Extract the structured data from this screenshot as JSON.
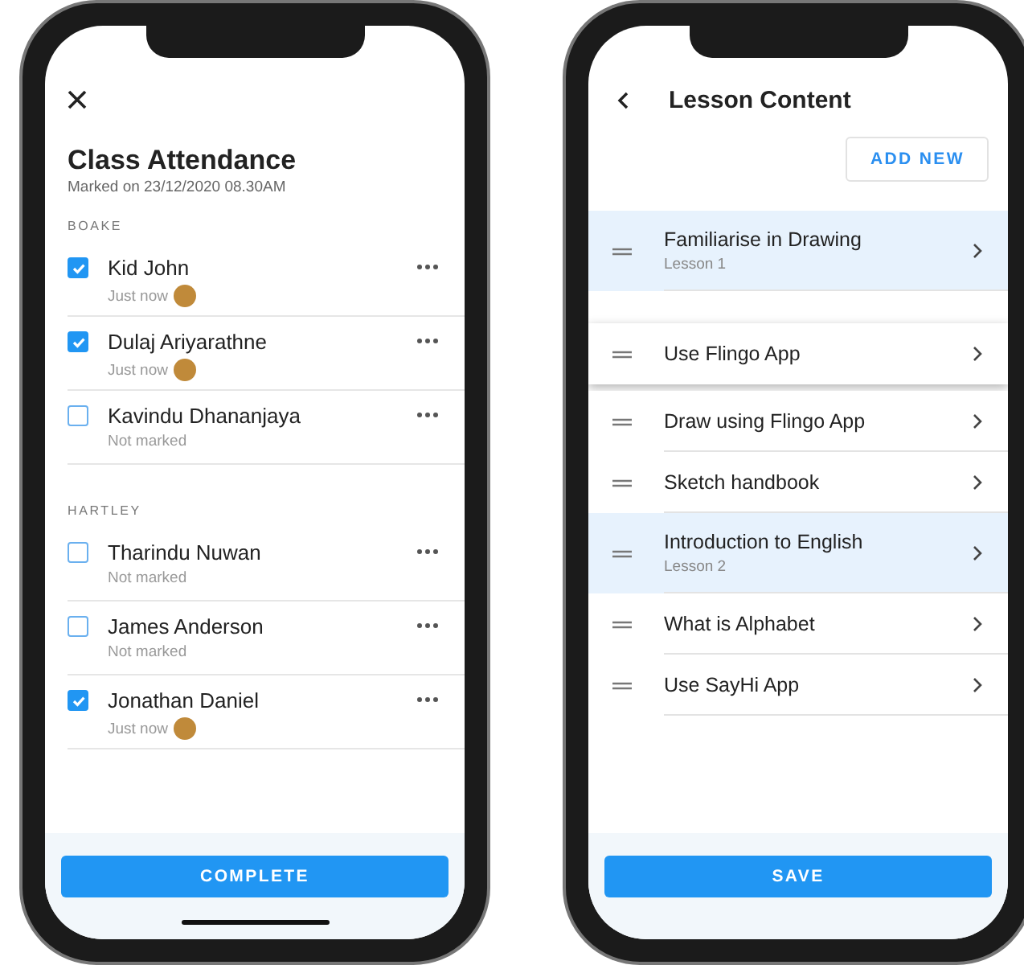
{
  "attendance_screen": {
    "title": "Class Attendance",
    "subtitle": "Marked on 23/12/2020 08.30AM",
    "groups": [
      {
        "name": "BOAKE",
        "students": [
          {
            "name": "Kid John",
            "status": "Just now",
            "checked": true
          },
          {
            "name": "Dulaj Ariyarathne",
            "status": "Just now",
            "checked": true
          },
          {
            "name": "Kavindu Dhananjaya",
            "status": "Not marked",
            "checked": false
          }
        ]
      },
      {
        "name": "HARTLEY",
        "students": [
          {
            "name": "Tharindu Nuwan",
            "status": "Not marked",
            "checked": false
          },
          {
            "name": "James Anderson",
            "status": "Not marked",
            "checked": false
          },
          {
            "name": "Jonathan Daniel",
            "status": "Just now",
            "checked": true
          }
        ]
      }
    ],
    "button": "COMPLETE"
  },
  "lesson_screen": {
    "title": "Lesson Content",
    "add_button": "ADD NEW",
    "items": [
      {
        "kind": "row",
        "title": "Familiarise in Drawing",
        "subtitle": "Lesson 1",
        "selected": true
      },
      {
        "kind": "dragging",
        "title": "Use Flingo App",
        "selected": false
      },
      {
        "kind": "row",
        "title": "Draw using Flingo App",
        "selected": false
      },
      {
        "kind": "row",
        "title": "Sketch handbook",
        "selected": false
      },
      {
        "kind": "row",
        "title": "Introduction to English",
        "subtitle": "Lesson 2",
        "selected": true
      },
      {
        "kind": "row",
        "title": "What is Alphabet",
        "selected": false
      },
      {
        "kind": "row",
        "title": "Use SayHi App",
        "selected": false
      }
    ],
    "button": "SAVE"
  }
}
